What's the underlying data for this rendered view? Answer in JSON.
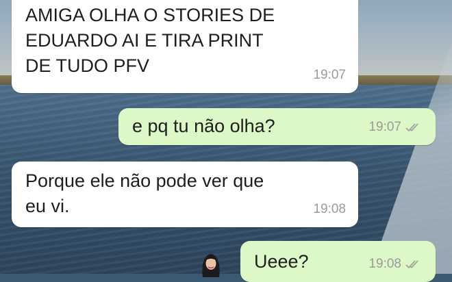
{
  "messages": [
    {
      "direction": "incoming",
      "text": "AMIGA OLHA O STORIES DE\nEDUARDO AI E TIRA PRINT\nDE TUDO PFV",
      "time": "19:07"
    },
    {
      "direction": "outgoing",
      "text": "e pq tu não olha?",
      "time": "19:07",
      "status": "read-double-check"
    },
    {
      "direction": "incoming",
      "text": "Porque ele não pode ver que\neu vi.",
      "time": "19:08"
    },
    {
      "direction": "outgoing",
      "text": "Ueee?",
      "time": "19:08",
      "status": "read-double-check"
    }
  ],
  "colors": {
    "incoming_bubble": "#ffffff",
    "outgoing_bubble": "#dcf8c6",
    "timestamp": "#9a9a9a",
    "tick": "#a0a0a0"
  },
  "icons": {
    "read_receipt": "double-check-icon",
    "sticker": "girl-avatar-sticker"
  }
}
